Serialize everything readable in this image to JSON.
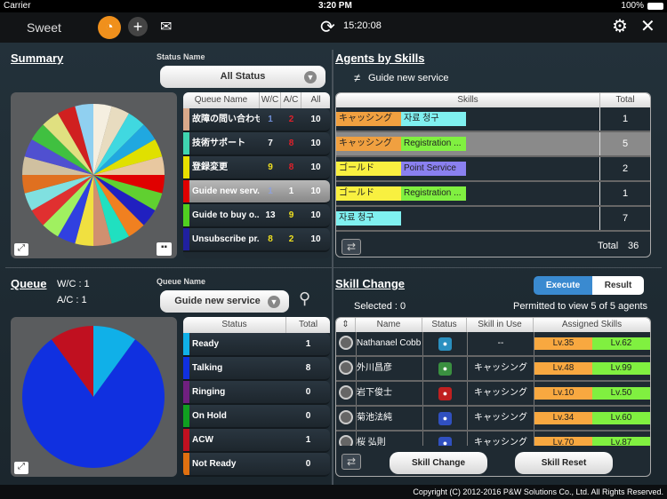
{
  "status_bar": {
    "carrier": "Carrier",
    "time": "3:20 PM",
    "battery": "100%"
  },
  "nav": {
    "app_name": "Sweet",
    "clock": "15:20:08"
  },
  "summary": {
    "title": "Summary",
    "status_label": "Status Name",
    "status_value": "All Status",
    "headers": [
      "Queue Name",
      "W/C",
      "A/C",
      "All"
    ],
    "rows": [
      {
        "name": "故障の問い合わせ",
        "wc": "1",
        "ac": "2",
        "all": "10",
        "color": "#d9a98a",
        "wc_color": "#6f8fd8",
        "ac_color": "#e0202a"
      },
      {
        "name": "技術サポート",
        "wc": "7",
        "ac": "8",
        "all": "10",
        "color": "#3fd4b0",
        "wc_color": "#ffffff",
        "ac_color": "#e0202a"
      },
      {
        "name": "登録変更",
        "wc": "9",
        "ac": "8",
        "all": "10",
        "color": "#e8e000",
        "wc_color": "#f0e020",
        "ac_color": "#e0202a"
      },
      {
        "name": "Guide new serv...",
        "wc": "1",
        "ac": "1",
        "all": "10",
        "color": "#e00000",
        "wc_color": "#8fa0d8",
        "ac_color": "#ffffff",
        "selected": true
      },
      {
        "name": "Guide to buy o...",
        "wc": "13",
        "ac": "9",
        "all": "10",
        "color": "#50d020",
        "wc_color": "#ffffff",
        "ac_color": "#f0e020"
      },
      {
        "name": "Unsubscribe pr...",
        "wc": "8",
        "ac": "2",
        "all": "10",
        "color": "#2020a0",
        "wc_color": "#f0e020",
        "ac_color": "#f0e020"
      }
    ],
    "pie_colors": [
      "#f5efe0",
      "#e8dcc0",
      "#40d8e0",
      "#20a8e0",
      "#e0e000",
      "#e8c8a0",
      "#e00000",
      "#60d030",
      "#2020c0",
      "#f08020",
      "#20e0c0",
      "#d09070",
      "#f0e040",
      "#3040e0",
      "#a0f060",
      "#e03030",
      "#80e0e0",
      "#e07020",
      "#d0c0a0",
      "#5050d0",
      "#40c040",
      "#e0e080",
      "#d02020",
      "#90d0f0"
    ]
  },
  "agents": {
    "title": "Agents by Skills",
    "filter_icon": "not-equal",
    "filter": "Guide new service",
    "headers": [
      "Skills",
      "Total"
    ],
    "rows": [
      {
        "skills": [
          {
            "t": "キャッシング",
            "c": "#f0a040"
          },
          {
            "t": "자료 청구",
            "c": "#7ff0f0"
          }
        ],
        "total": "1"
      },
      {
        "skills": [
          {
            "t": "キャッシング",
            "c": "#f0a040"
          },
          {
            "t": "Registration ...",
            "c": "#80f040"
          }
        ],
        "total": "5",
        "selected": true
      },
      {
        "skills": [
          {
            "t": "ゴールド",
            "c": "#f8f040"
          },
          {
            "t": "Point Service",
            "c": "#8a80f0"
          }
        ],
        "total": "2"
      },
      {
        "skills": [
          {
            "t": "ゴールド",
            "c": "#f8f040"
          },
          {
            "t": "Registration ...",
            "c": "#80f040"
          }
        ],
        "total": "1"
      },
      {
        "skills": [
          {
            "t": "자료 청구",
            "c": "#7ff0f0"
          }
        ],
        "total": "7"
      }
    ],
    "total_label": "Total",
    "total_value": "36"
  },
  "queue": {
    "title": "Queue",
    "wc": "W/C : 1",
    "ac": "A/C : 1",
    "queue_label": "Queue Name",
    "queue_value": "Guide new service",
    "headers": [
      "Status",
      "Total"
    ],
    "rows": [
      {
        "name": "Ready",
        "total": 1,
        "color": "#10b0e8"
      },
      {
        "name": "Talking",
        "total": 8,
        "color": "#1030e0"
      },
      {
        "name": "Ringing",
        "total": 0,
        "color": "#702080"
      },
      {
        "name": "On Hold",
        "total": 0,
        "color": "#10a020"
      },
      {
        "name": "ACW",
        "total": 1,
        "color": "#c01020"
      },
      {
        "name": "Not Ready",
        "total": 0,
        "color": "#e07010"
      }
    ]
  },
  "skill_change": {
    "title": "Skill Change",
    "execute": "Execute",
    "result": "Result",
    "selected": "Selected : 0",
    "permitted": "Permitted to view 5 of 5 agents",
    "headers": [
      "Name",
      "Status",
      "Skill in Use",
      "Assigned Skills"
    ],
    "rows": [
      {
        "name": "Nathanael Cobb",
        "status_icon": "hourglass",
        "status_color": "#2a90c0",
        "skill": "--",
        "lv": [
          "Lv.35",
          "Lv.62"
        ]
      },
      {
        "name": "外川昌彦",
        "status_icon": "phone-ringing",
        "status_color": "#3a9040",
        "skill": "キャッシング",
        "lv": [
          "Lv.48",
          "Lv.99"
        ]
      },
      {
        "name": "岩下俊士",
        "status_icon": "document",
        "status_color": "#c02020",
        "skill": "キャッシング",
        "lv": [
          "Lv.10",
          "Lv.50"
        ]
      },
      {
        "name": "菊池法純",
        "status_icon": "phone",
        "status_color": "#3050c0",
        "skill": "キャッシング",
        "lv": [
          "Lv.34",
          "Lv.60"
        ]
      },
      {
        "name": "桜 弘則",
        "status_icon": "phone",
        "status_color": "#3050c0",
        "skill": "キャッシング",
        "lv": [
          "Lv.70",
          "Lv.87"
        ]
      }
    ],
    "skill_change_btn": "Skill Change",
    "skill_reset_btn": "Skill Reset"
  },
  "footer": {
    "copyright": "Copyright (C) 2012-2016 P&W Solutions Co., Ltd. All Rights Reserved."
  }
}
